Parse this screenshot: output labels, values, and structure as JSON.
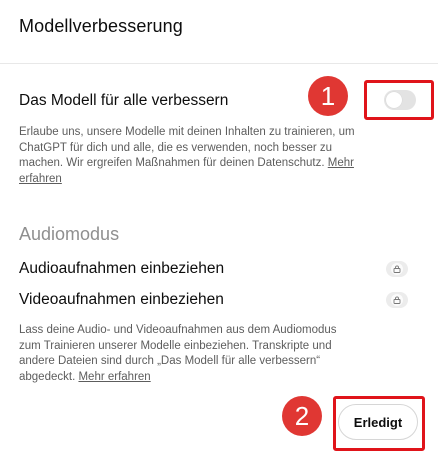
{
  "dialog": {
    "title": "Modellverbesserung"
  },
  "improve": {
    "label": "Das Modell für alle verbessern",
    "desc_lines": [
      "Erlaube uns, unsere Modelle mit deinen Inhalten zu trainieren, um",
      "ChatGPT für dich und alle, die es verwenden, noch besser zu",
      "machen. Wir ergreifen Maßnahmen für deinen Datenschutz."
    ],
    "link_part1": "Mehr",
    "link_part2": "erfahren",
    "toggle_on": false
  },
  "audio": {
    "heading": "Audiomodus",
    "audio_label": "Audioaufnahmen einbeziehen",
    "video_label": "Videoaufnahmen einbeziehen",
    "desc_lines": [
      "Lass deine Audio- und Videoaufnahmen aus dem Audiomodus",
      "zum Trainieren unserer Modelle einbeziehen. Transkripte und",
      "andere Dateien sind durch „Das Modell für alle verbessern“"
    ],
    "desc_last": "abgedeckt.",
    "link": "Mehr erfahren"
  },
  "footer": {
    "done_label": "Erledigt"
  },
  "annotations": {
    "badge1": "1",
    "badge2": "2",
    "color": "#e0141a"
  }
}
